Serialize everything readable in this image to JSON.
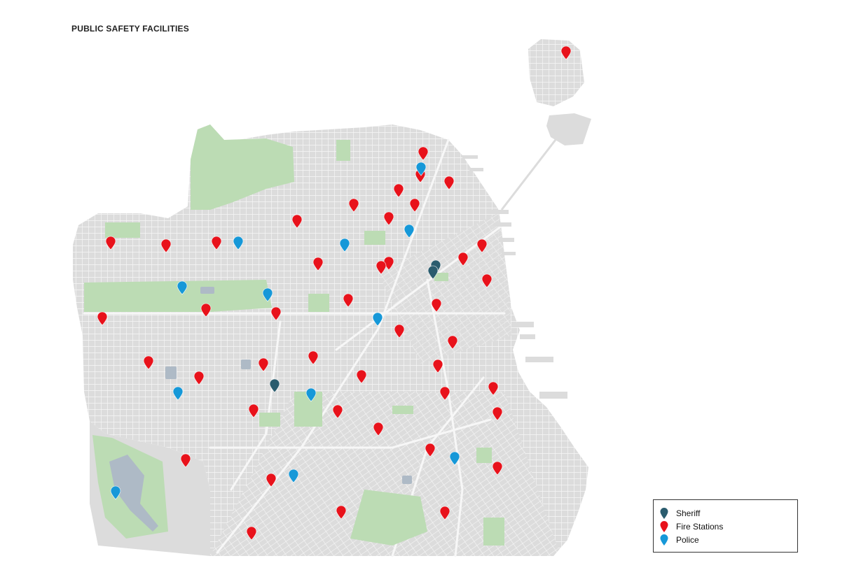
{
  "map": {
    "title": "PUBLIC SAFETY FACILITIES",
    "colors": {
      "land": "#dcdcdc",
      "streets": "#f4f4f4",
      "parks": "#bcdcb4",
      "water": "#aebac6",
      "sheriff": "#2a5c6e",
      "fire": "#e8121b",
      "police": "#1698d8"
    },
    "legend": {
      "items": [
        {
          "key": "sheriff",
          "label": "Sheriff",
          "icon": "map-pin-icon"
        },
        {
          "key": "fire",
          "label": "Fire Stations",
          "icon": "map-pin-icon"
        },
        {
          "key": "police",
          "label": "Police",
          "icon": "map-pin-icon"
        }
      ]
    }
  }
}
